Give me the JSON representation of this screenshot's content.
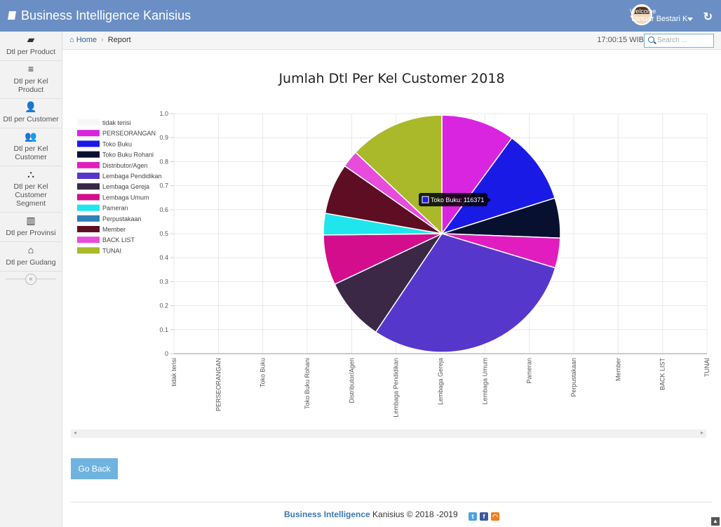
{
  "app": {
    "title": "Business Intelligence Kanisius",
    "refresh_icon": "refresh-icon"
  },
  "user": {
    "welcome": "Welcome",
    "name": "Yanuar Bestari K"
  },
  "sidebar": {
    "items": [
      {
        "label": "Dtl per Product",
        "icon": "book-icon",
        "glyph": "▰"
      },
      {
        "label": "Dtl per Kel Product",
        "icon": "list-icon",
        "glyph": "≡"
      },
      {
        "label": "Dtl per Customer",
        "icon": "user-icon",
        "glyph": "👤"
      },
      {
        "label": "Dtl per Kel Customer",
        "icon": "users-icon",
        "glyph": "👥"
      },
      {
        "label": "Dtl per Kel Customer Segment",
        "icon": "sitemap-icon",
        "glyph": "⛬"
      },
      {
        "label": "Dtl per Provinsi",
        "icon": "map-icon",
        "glyph": "▥"
      },
      {
        "label": "Dtl per Gudang",
        "icon": "home-icon",
        "glyph": "⌂"
      }
    ],
    "collapse": "«"
  },
  "breadcrumb": {
    "home": "Home",
    "current": "Report"
  },
  "clock": "17:00:15 WIB",
  "search": {
    "placeholder": "Search ..."
  },
  "chart_data": {
    "type": "pie",
    "title": "Jumlah Dtl Per Kel Customer 2018",
    "categories": [
      "tidak terisi",
      "PERSEORANGAN",
      "Toko Buku",
      "Toko Buku Rohani",
      "Distributor/Agen",
      "Lembaga Pendidikan",
      "Lembaga Gereja",
      "Lembaga Umum",
      "Pameran",
      "Perpustakaan",
      "Member",
      "BACK LIST",
      "TUNAI"
    ],
    "colors": [
      "#f7f7f7",
      "#d925e0",
      "#1a1ae6",
      "#07102e",
      "#e21dbf",
      "#5637cc",
      "#3a2846",
      "#d40d8c",
      "#1fe6ec",
      "#2e80b8",
      "#5e0e22",
      "#e84cdb",
      "#a9b92a"
    ],
    "values": [
      0,
      116371,
      116371,
      63000,
      47000,
      344000,
      99000,
      79000,
      34000,
      0,
      80000,
      27000,
      150000
    ],
    "tooltip": "Toko Buku: 116371",
    "yticks": [
      "1.0",
      "0.9",
      "0.8",
      "0.7",
      "0.6",
      "0.5",
      "0.4",
      "0.3",
      "0.2",
      "0.1",
      "0"
    ],
    "ylim": [
      0,
      1
    ],
    "grid": true,
    "legend": "left"
  },
  "buttons": {
    "go_back": "Go Back"
  },
  "footer": {
    "brand": "Business Intelligence",
    "rest": " Kanisius © 2018 -2019"
  }
}
